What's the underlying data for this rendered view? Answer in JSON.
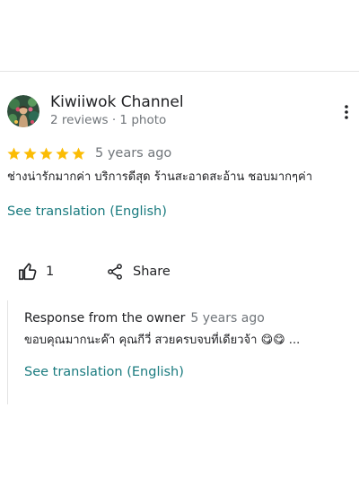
{
  "review": {
    "reviewer_name": "Kiwiiwok Channel",
    "reviewer_meta": "2 reviews · 1 photo",
    "rating": 5,
    "rating_max": 5,
    "star_color": "#fbbc04",
    "date": "5 years ago",
    "text": "ช่างน่ารักมากค่า บริการดีสุด ร้านสะอาดสะอ้าน ชอบมากๆค่า",
    "translation_link": "See translation (English)",
    "like_count": "1",
    "share_label": "Share",
    "icons": {
      "more": "more-vert-icon",
      "like": "thumbs-up-icon",
      "share": "share-icon"
    }
  },
  "owner_response": {
    "label": "Response from the owner",
    "date": "5 years ago",
    "text": "ขอบคุณมากนะค๊า คุณกีวี่ สวยครบจบที่เดียวจ้า 😋😋 ...",
    "translation_link": "See translation (English)"
  },
  "colors": {
    "link": "#1a7b7f",
    "secondary_text": "#70757a",
    "divider": "#e3e3e3"
  }
}
